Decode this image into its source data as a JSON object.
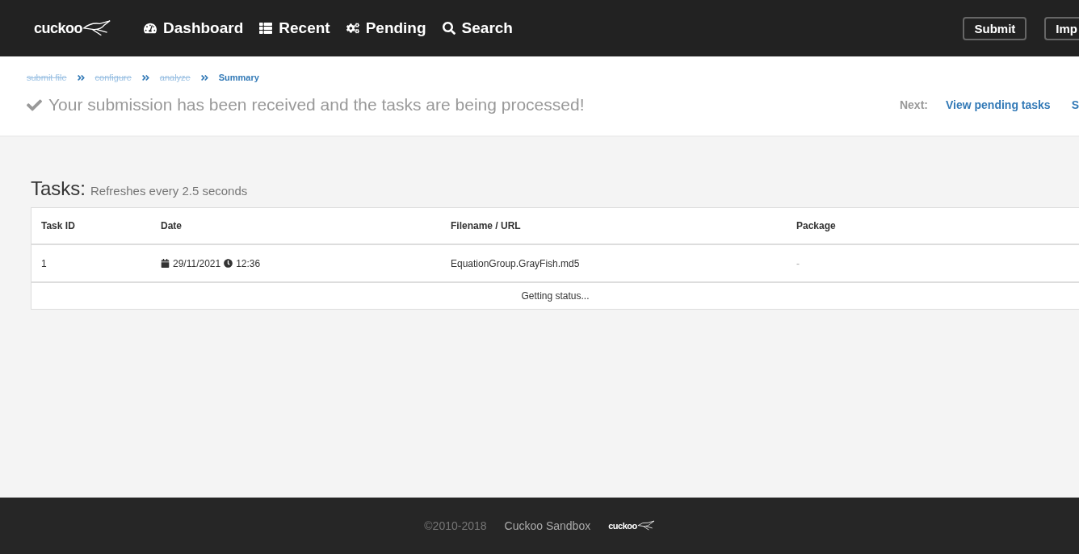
{
  "navbar": {
    "logo": "cuckoo",
    "items": [
      {
        "kind": "dashboard",
        "label": "Dashboard"
      },
      {
        "kind": "recent",
        "label": "Recent"
      },
      {
        "kind": "pending",
        "label": "Pending"
      },
      {
        "kind": "search",
        "label": "Search"
      }
    ],
    "buttons": [
      "Submit",
      "Imp"
    ]
  },
  "breadcrumb": [
    {
      "label": "submit file",
      "done": true
    },
    {
      "label": "configure",
      "done": true
    },
    {
      "label": "analyze",
      "done": true
    },
    {
      "label": "Summary",
      "done": false
    }
  ],
  "message": "Your submission has been received and the tasks are being processed!",
  "next": {
    "label": "Next:",
    "links": [
      "View pending tasks",
      "S"
    ]
  },
  "tasks": {
    "title": "Tasks:",
    "subtitle": "Refreshes every 2.5 seconds",
    "columns": [
      "Task ID",
      "Date",
      "Filename / URL",
      "Package"
    ],
    "rows": [
      {
        "id": "1",
        "date": "29/11/2021",
        "time": "12:36",
        "filename": "EquationGroup.GrayFish.md5",
        "package": "-"
      }
    ],
    "status": "Getting status..."
  },
  "footer": {
    "copyright": "©2010-2018",
    "name": "Cuckoo Sandbox",
    "logo": "cuckoo"
  }
}
